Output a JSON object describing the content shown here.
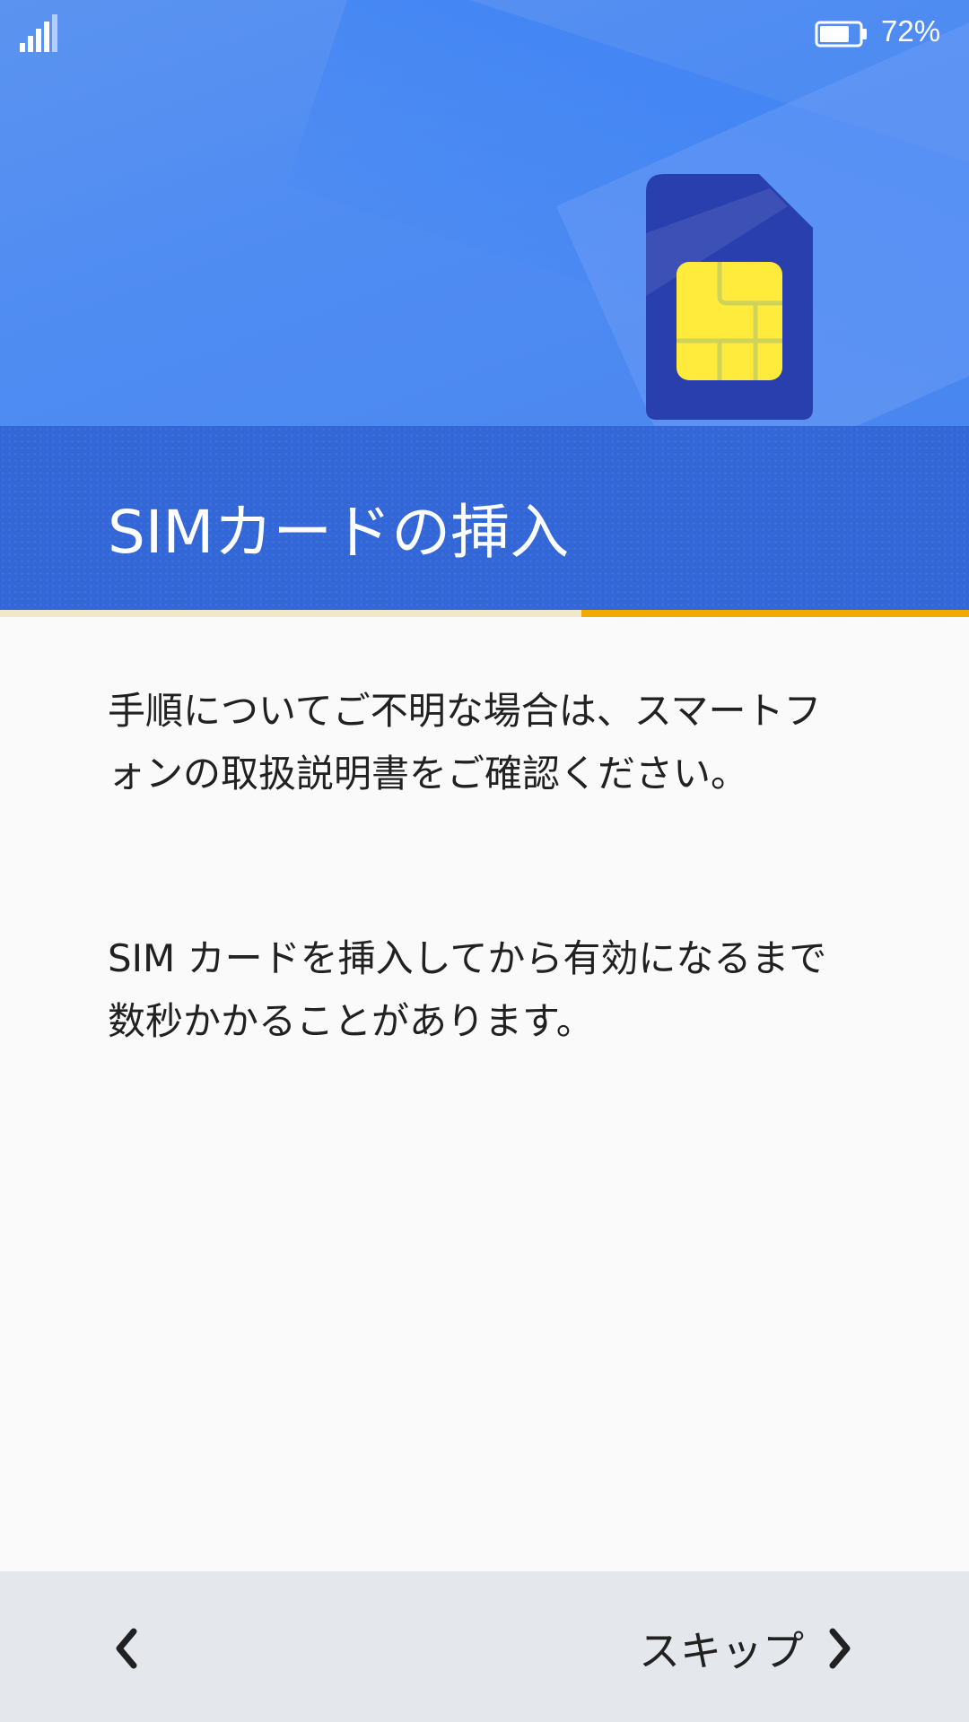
{
  "status_bar": {
    "signal_icon": "signal-icon",
    "battery_icon": "battery-icon",
    "battery_percent": "72%"
  },
  "hero": {
    "illustration": "sim-card-icon",
    "title": "SIMカードの挿入"
  },
  "progress": {
    "fraction": 0.4
  },
  "content": {
    "paragraph1": "手順についてご不明な場合は、スマートフォンの取扱説明書をご確認ください。",
    "paragraph2": "SIM カードを挿入してから有効になるまで数秒かかることがあります。"
  },
  "navigation": {
    "back_icon": "chevron-left-icon",
    "skip_label": "スキップ",
    "skip_icon": "chevron-right-icon"
  },
  "colors": {
    "hero_blue": "#4f8cf2",
    "title_band": "#3366d6",
    "progress_accent": "#f1ab00",
    "sim_body": "#2a3fae",
    "sim_chip": "#ffeb3b"
  }
}
